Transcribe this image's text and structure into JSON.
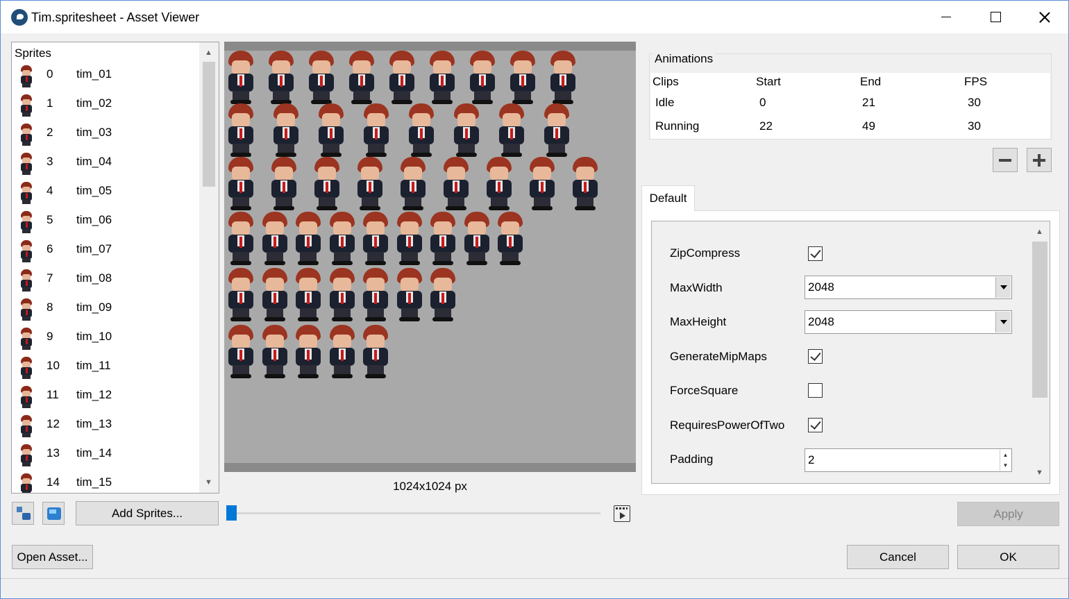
{
  "window": {
    "title": "Tim.spritesheet - Asset Viewer",
    "app_icon": "asset-viewer-logo"
  },
  "sprites": {
    "header": "Sprites",
    "items": [
      {
        "index": "0",
        "name": "tim_01"
      },
      {
        "index": "1",
        "name": "tim_02"
      },
      {
        "index": "2",
        "name": "tim_03"
      },
      {
        "index": "3",
        "name": "tim_04"
      },
      {
        "index": "4",
        "name": "tim_05"
      },
      {
        "index": "5",
        "name": "tim_06"
      },
      {
        "index": "6",
        "name": "tim_07"
      },
      {
        "index": "7",
        "name": "tim_08"
      },
      {
        "index": "8",
        "name": "tim_09"
      },
      {
        "index": "9",
        "name": "tim_10"
      },
      {
        "index": "10",
        "name": "tim_11"
      },
      {
        "index": "11",
        "name": "tim_12"
      },
      {
        "index": "12",
        "name": "tim_13"
      },
      {
        "index": "13",
        "name": "tim_14"
      },
      {
        "index": "14",
        "name": "tim_15"
      }
    ]
  },
  "preview": {
    "dimensions": "1024x1024 px",
    "sprite_count": 50
  },
  "bottom_left": {
    "add_sprites_label": "Add Sprites...",
    "open_asset_label": "Open Asset..."
  },
  "animations": {
    "legend": "Animations",
    "columns": [
      "Clips",
      "Start",
      "End",
      "FPS"
    ],
    "rows": [
      {
        "clip": "Idle",
        "start": "0",
        "end": "21",
        "fps": "30"
      },
      {
        "clip": "Running",
        "start": "22",
        "end": "49",
        "fps": "30"
      }
    ]
  },
  "tabs": {
    "default_label": "Default"
  },
  "properties": {
    "zip_compress": {
      "label": "ZipCompress",
      "checked": true
    },
    "max_width": {
      "label": "MaxWidth",
      "value": "2048"
    },
    "max_height": {
      "label": "MaxHeight",
      "value": "2048"
    },
    "generate_mip_maps": {
      "label": "GenerateMipMaps",
      "checked": true
    },
    "force_square": {
      "label": "ForceSquare",
      "checked": false
    },
    "requires_power_of_two": {
      "label": "RequiresPowerOfTwo",
      "checked": true
    },
    "padding": {
      "label": "Padding",
      "value": "2"
    }
  },
  "actions": {
    "apply_label": "Apply",
    "cancel_label": "Cancel",
    "ok_label": "OK"
  },
  "colors": {
    "accent": "#0078d7",
    "hair": "#9b3420",
    "suit": "#1c2130",
    "tie": "#c81a1a"
  }
}
